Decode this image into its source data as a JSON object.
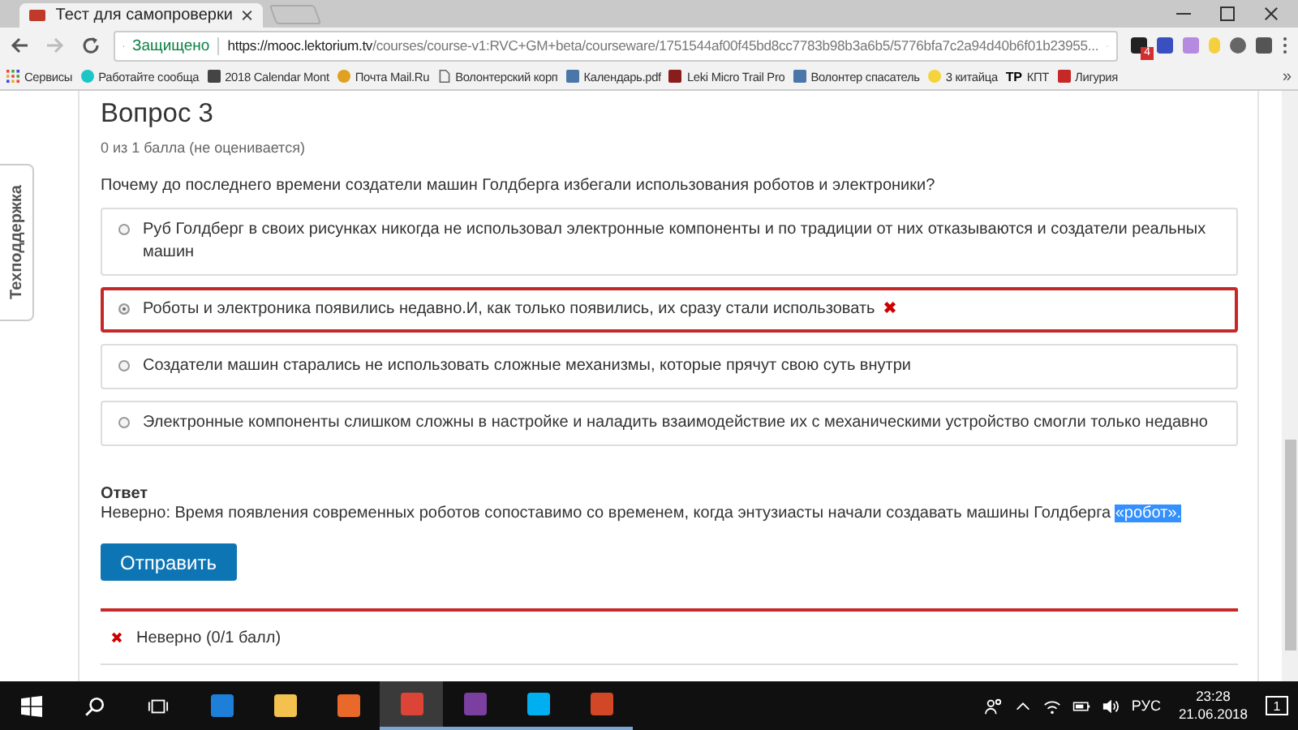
{
  "browser": {
    "tab_title": "Тест для самопроверки",
    "secure_label": "Защищено",
    "url_host": "https://mooc.lektorium.tv",
    "url_path": "/courses/course-v1:RVC+GM+beta/courseware/1751544af00f45bd8cc7783b98b3a6b5/5776bfa7c2a94d40b6f01b23955...",
    "extension_badge": "4"
  },
  "bookmarks": [
    {
      "label": "Сервисы",
      "kind": "apps"
    },
    {
      "label": "Работайте сообща",
      "kind": "circle"
    },
    {
      "label": "2018 Calendar Mont",
      "kind": "calendar"
    },
    {
      "label": "Почта Mail.Ru",
      "kind": "mail"
    },
    {
      "label": "Волонтерский корп",
      "kind": "page"
    },
    {
      "label": "Календарь.pdf",
      "kind": "vk"
    },
    {
      "label": "Leki Micro Trail Pro",
      "kind": "shop"
    },
    {
      "label": "Волонтер спасатель",
      "kind": "vk"
    },
    {
      "label": "3 китайца",
      "kind": "smile"
    },
    {
      "label": "КПТ",
      "kind": "tp",
      "icon_text": "TP"
    },
    {
      "label": "Лигурия",
      "kind": "flag"
    }
  ],
  "bookmarks_more": "»",
  "support_tab": "Техподдержка",
  "question": {
    "title": "Вопрос 3",
    "score": "0 из 1 балла (не оценивается)",
    "text": "Почему до последнего времени создатели машин Голдберга избегали использования роботов и электроники?",
    "options": [
      {
        "text": "Руб Голдберг в своих рисунках никогда не использовал электронные компоненты и по традиции от них отказываются и создатели реальных машин",
        "selected": false,
        "incorrect": false
      },
      {
        "text": "Роботы и электроника появились недавно.И, как только появились, их сразу стали использовать",
        "selected": true,
        "incorrect": true
      },
      {
        "text": "Создатели машин старались не использовать сложные механизмы, которые прячут свою суть внутри",
        "selected": false,
        "incorrect": false
      },
      {
        "text": "Электронные компоненты слишком сложны в настройке и наладить взаимодействие их с механическими устройство смогли только недавно",
        "selected": false,
        "incorrect": false
      }
    ]
  },
  "answer": {
    "heading": "Ответ",
    "text": "Неверно:  Время появления современных роботов сопоставимо со временем, когда энтузиасты начали создавать машины Голдберга ",
    "highlighted": "«робот»."
  },
  "submit_button": "Отправить",
  "result": {
    "text": "Неверно (0/1 балл)",
    "correct": false
  },
  "taskbar": {
    "apps": [
      {
        "kind": "start"
      },
      {
        "kind": "search"
      },
      {
        "kind": "taskview"
      },
      {
        "kind": "edge"
      },
      {
        "kind": "explorer"
      },
      {
        "kind": "media"
      },
      {
        "kind": "chrome",
        "selected": true
      },
      {
        "kind": "onenote",
        "selected": false
      },
      {
        "kind": "skype",
        "selected": false
      },
      {
        "kind": "powerpoint",
        "selected": false
      }
    ],
    "language": "РУС",
    "time": "23:28",
    "date": "21.06.2018",
    "notifications": "1"
  }
}
